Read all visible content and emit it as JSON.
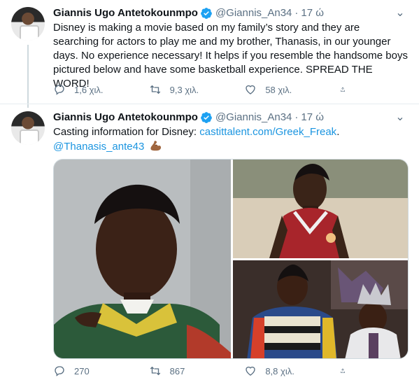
{
  "tweets": [
    {
      "author": {
        "name": "Giannis Ugo Antetokounmpo",
        "handle": "@Giannis_An34",
        "time": "17 ώ"
      },
      "text": "Disney is making a movie based on my family’s story and they are searching for actors to play me and my brother, Thanasis, in our younger days. No experience necessary! It helps if you resemble the handsome boys pictured below and have some basketball experience. SPREAD THE WORD!",
      "actions": {
        "reply_count": "1,6 χιλ.",
        "retweet_count": "9,3 χιλ.",
        "like_count": "58 χιλ."
      }
    },
    {
      "author": {
        "name": "Giannis Ugo Antetokounmpo",
        "handle": "@Giannis_An34",
        "time": "17 ώ"
      },
      "text_prefix": "Casting information for Disney: ",
      "link": "castittalent.com/Greek_Freak",
      "text_suffix": ".",
      "mention": "@Thanasis_ante43",
      "emoji": "flexed-biceps",
      "actions": {
        "reply_count": "270",
        "retweet_count": "867",
        "like_count": "8,8 χιλ."
      }
    }
  ],
  "colors": {
    "accent": "#1b95e0",
    "secondary_text": "#5b7083",
    "verified": "#1da1f2"
  }
}
